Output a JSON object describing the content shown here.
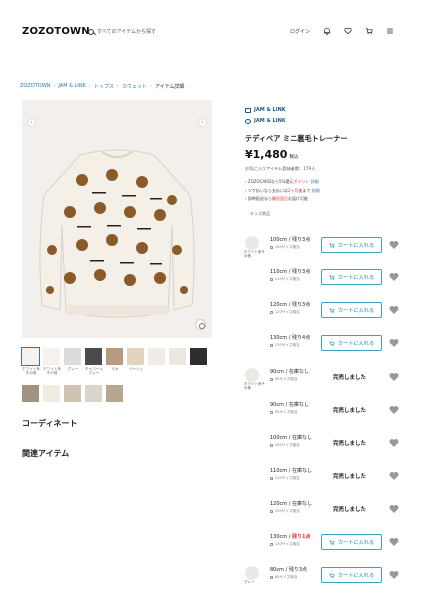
{
  "header": {
    "logo": "ZOZOTOWN",
    "search_placeholder": "すべてのアイテムから探す",
    "login": "ログイン"
  },
  "breadcrumb": [
    "ZOZOTOWN",
    "JAM & LINK",
    "トップス",
    "スウェット",
    "アイテム詳細"
  ],
  "thumbnails_row1": [
    {
      "label": "ホワイト系その他"
    },
    {
      "label": "ホワイト系その他"
    },
    {
      "label": "グレー"
    },
    {
      "label": "チャコールグレー"
    },
    {
      "label": "モカ"
    },
    {
      "label": "ベージュ"
    },
    {
      "label": ""
    },
    {
      "label": ""
    },
    {
      "label": ""
    }
  ],
  "sections": {
    "coordinate": "コーディネート",
    "related": "関連アイテム"
  },
  "product": {
    "brand1": "JAM & LINK",
    "brand2": "JAM & LINK",
    "title": "テディベア ミニ裏毛トレーナー",
    "price": "¥1,480",
    "tax": "税込",
    "viewing": "お気に入りアイテム登録者数：179人",
    "bullet1_pre": "ZOZOCARDなら5%還元",
    "bullet1_red": "ポイント",
    "bullet1_link": "詳細",
    "bullet2_pre": "ツケ払いなら支払いは",
    "bullet2_red": "2ヶ月後",
    "bullet2_post": "まで",
    "bullet2_link": "詳細",
    "bullet3_pre": "即時配送なら",
    "bullet3_red": "最短翌日",
    "bullet3_post": "お届け可能",
    "size_info": "キッズ商品"
  },
  "stock_rows": [
    {
      "color": "ホワイト系その他",
      "size": "100cm",
      "stock": "残り3点",
      "sub": "100サイズ相当",
      "available": true,
      "red": false,
      "swatch": true
    },
    {
      "color": "",
      "size": "110cm",
      "stock": "残り3点",
      "sub": "110サイズ相当",
      "available": true,
      "red": false,
      "swatch": false
    },
    {
      "color": "",
      "size": "120cm",
      "stock": "残り3点",
      "sub": "120サイズ相当",
      "available": true,
      "red": false,
      "swatch": false
    },
    {
      "color": "",
      "size": "130cm",
      "stock": "残り4点",
      "sub": "130サイズ相当",
      "available": true,
      "red": false,
      "swatch": false
    },
    {
      "color": "ホワイト系その他",
      "size": "90cm",
      "stock": "在庫なし",
      "sub": "90サイズ相当",
      "available": false,
      "red": false,
      "swatch": true
    },
    {
      "color": "",
      "size": "90cm",
      "stock": "在庫なし",
      "sub": "90サイズ相当",
      "available": false,
      "red": false,
      "swatch": false
    },
    {
      "color": "",
      "size": "100cm",
      "stock": "在庫なし",
      "sub": "100サイズ相当",
      "available": false,
      "red": false,
      "swatch": false
    },
    {
      "color": "",
      "size": "110cm",
      "stock": "在庫なし",
      "sub": "110サイズ相当",
      "available": false,
      "red": false,
      "swatch": false
    },
    {
      "color": "",
      "size": "120cm",
      "stock": "在庫なし",
      "sub": "120サイズ相当",
      "available": false,
      "red": false,
      "swatch": false
    },
    {
      "color": "",
      "size": "130cm",
      "stock": "残り1点",
      "sub": "130サイズ相当",
      "available": true,
      "red": true,
      "swatch": false
    },
    {
      "color": "グレー",
      "size": "80cm",
      "stock": "残り3点",
      "sub": "80サイズ相当",
      "available": true,
      "red": false,
      "swatch": true
    }
  ],
  "labels": {
    "cart": "カートに入れる",
    "soldout": "完売しました",
    "zoom": "",
    "prev": "‹",
    "next": "›"
  },
  "colors": {
    "accent": "#39a3c6",
    "brand": "#1b5b8c",
    "red": "#dd3333"
  }
}
